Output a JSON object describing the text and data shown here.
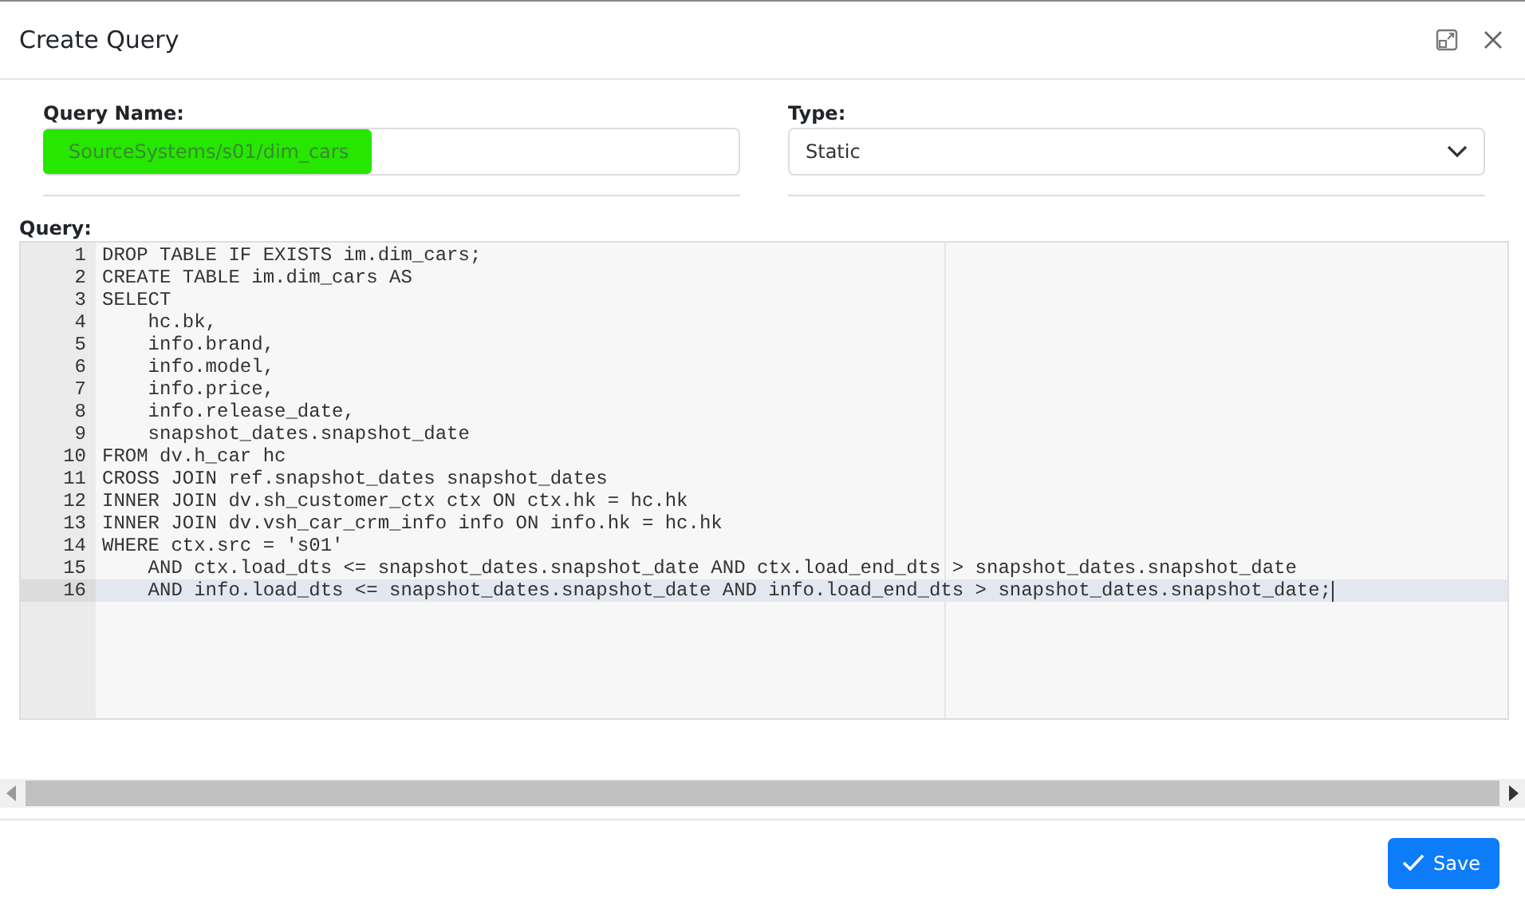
{
  "dialog": {
    "title": "Create Query"
  },
  "name_field": {
    "label": "Query Name:",
    "value": "SourceSystems/s01/dim_cars"
  },
  "type_field": {
    "label": "Type:",
    "value": "Static"
  },
  "query": {
    "label": "Query:",
    "lines": [
      {
        "number": "1",
        "text": "DROP TABLE IF EXISTS im.dim_cars;",
        "current": false
      },
      {
        "number": "2",
        "text": "CREATE TABLE im.dim_cars AS",
        "current": false
      },
      {
        "number": "3",
        "text": "SELECT",
        "current": false
      },
      {
        "number": "4",
        "text": "    hc.bk,",
        "current": false
      },
      {
        "number": "5",
        "text": "    info.brand,",
        "current": false
      },
      {
        "number": "6",
        "text": "    info.model,",
        "current": false
      },
      {
        "number": "7",
        "text": "    info.price,",
        "current": false
      },
      {
        "number": "8",
        "text": "    info.release_date,",
        "current": false
      },
      {
        "number": "9",
        "text": "    snapshot_dates.snapshot_date",
        "current": false
      },
      {
        "number": "10",
        "text": "FROM dv.h_car hc",
        "current": false
      },
      {
        "number": "11",
        "text": "CROSS JOIN ref.snapshot_dates snapshot_dates",
        "current": false
      },
      {
        "number": "12",
        "text": "INNER JOIN dv.sh_customer_ctx ctx ON ctx.hk = hc.hk",
        "current": false
      },
      {
        "number": "13",
        "text": "INNER JOIN dv.vsh_car_crm_info info ON info.hk = hc.hk",
        "current": false
      },
      {
        "number": "14",
        "text": "WHERE ctx.src = 's01'",
        "current": false
      },
      {
        "number": "15",
        "text": "    AND ctx.load_dts <= snapshot_dates.snapshot_date AND ctx.load_end_dts > snapshot_dates.snapshot_date",
        "current": false
      },
      {
        "number": "16",
        "text": "    AND info.load_dts <= snapshot_dates.snapshot_date AND info.load_end_dts > snapshot_dates.snapshot_date;",
        "current": true
      }
    ]
  },
  "save_button": {
    "label": "Save"
  }
}
